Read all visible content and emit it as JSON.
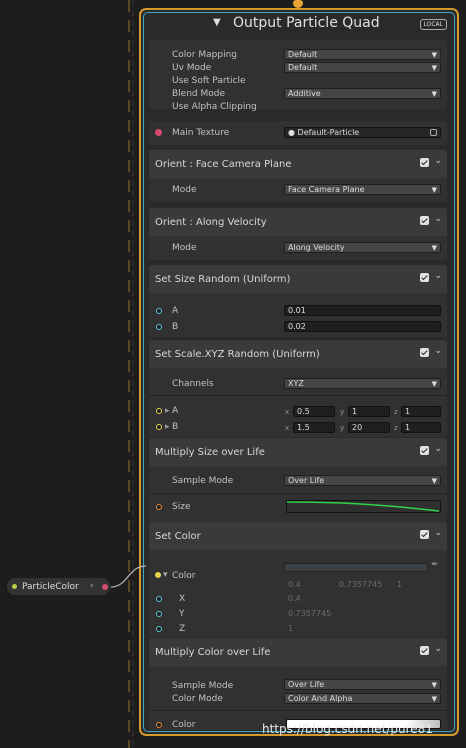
{
  "node": {
    "title": "Output Particle Quad",
    "badge": "LOCAL"
  },
  "settings": {
    "color_mapping_label": "Color Mapping",
    "color_mapping_value": "Default",
    "uv_mode_label": "Uv Mode",
    "uv_mode_value": "Default",
    "use_soft_particle_label": "Use Soft Particle",
    "blend_mode_label": "Blend Mode",
    "blend_mode_value": "Additive",
    "use_alpha_clipping_label": "Use Alpha Clipping",
    "main_texture_label": "Main Texture",
    "main_texture_value": "Default-Particle"
  },
  "blocks": {
    "orient_camera": {
      "title": "Orient : Face Camera Plane",
      "mode_label": "Mode",
      "mode_value": "Face Camera Plane"
    },
    "orient_velocity": {
      "title": "Orient : Along Velocity",
      "mode_label": "Mode",
      "mode_value": "Along Velocity"
    },
    "set_size": {
      "title": "Set Size Random (Uniform)",
      "a_label": "A",
      "a_value": "0.01",
      "b_label": "B",
      "b_value": "0.02"
    },
    "set_scale": {
      "title": "Set Scale.XYZ Random (Uniform)",
      "channels_label": "Channels",
      "channels_value": "XYZ",
      "a_label": "A",
      "a_x": "0.5",
      "a_y": "1",
      "a_z": "1",
      "b_label": "B",
      "b_x": "1.5",
      "b_y": "20",
      "b_z": "1",
      "x": "x",
      "y": "y",
      "z": "z"
    },
    "mult_size": {
      "title": "Multiply Size over Life",
      "sample_label": "Sample Mode",
      "sample_value": "Over Life",
      "size_label": "Size"
    },
    "set_color": {
      "title": "Set Color",
      "color_label": "Color",
      "x_label": "X",
      "y_label": "Y",
      "z_label": "Z",
      "row1_a": "0.4",
      "row1_b": "0.7357745",
      "row1_c": "1",
      "x_value": "0.4",
      "y_value": "0.7357745",
      "z_value": "1"
    },
    "mult_color": {
      "title": "Multiply Color over Life",
      "sample_label": "Sample Mode",
      "sample_value": "Over Life",
      "color_mode_label": "Color Mode",
      "color_mode_value": "Color And Alpha",
      "color_label": "Color"
    }
  },
  "property_node": {
    "name": "ParticleColor",
    "arrow": "‹"
  },
  "watermark": "https://blog.csdn.net/pure81",
  "colors": {
    "node_border": "#d39a2b",
    "port_blue": "#58cad6",
    "curve_green": "#2fd24a"
  }
}
